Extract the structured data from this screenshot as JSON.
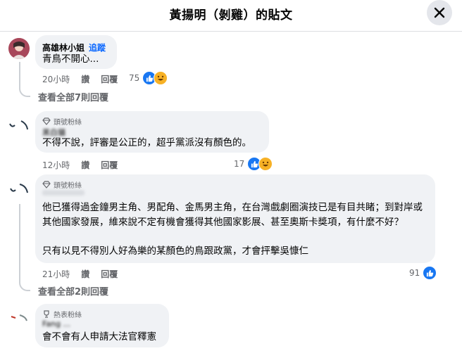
{
  "header": {
    "title": "黃揚明（剝雞）的貼文"
  },
  "comments": [
    {
      "name": "高雄林小姐",
      "follow": "追蹤",
      "text": "青鳥不開心...",
      "time": "20小時",
      "like": "讚",
      "reply": "回覆",
      "reactions": "75",
      "view_replies": "查看全部7則回覆"
    },
    {
      "badge": "頭號粉絲",
      "name_blurred": "黑白貓",
      "text": "不得不說，評審是公正的，超乎黨派沒有顏色的。",
      "time": "12小時",
      "like": "讚",
      "reply": "回覆",
      "reactions": "17"
    },
    {
      "badge": "頭號粉絲",
      "name_blurred": "",
      "text_p1": "他已獲得過金鐘男主角、男配角、金馬男主角，在台灣戲劇圈演技已是有目共睹；到對岸或其他國家發展，維來說不定有機會獲得其他國家影展、甚至奧斯卡獎項，有什麼不好？",
      "text_p2": "只有以見不得別人好為樂的某顏色的鳥跟政黨，才會抨擊吳慷仁",
      "time": "21小時",
      "like": "讚",
      "reply": "回覆",
      "reactions": "91",
      "view_replies": "查看全部2則回覆"
    },
    {
      "badge": "熱表粉絲",
      "name_blurred": "Fang ...",
      "text": "會不會有人申請大法官釋憲"
    }
  ]
}
